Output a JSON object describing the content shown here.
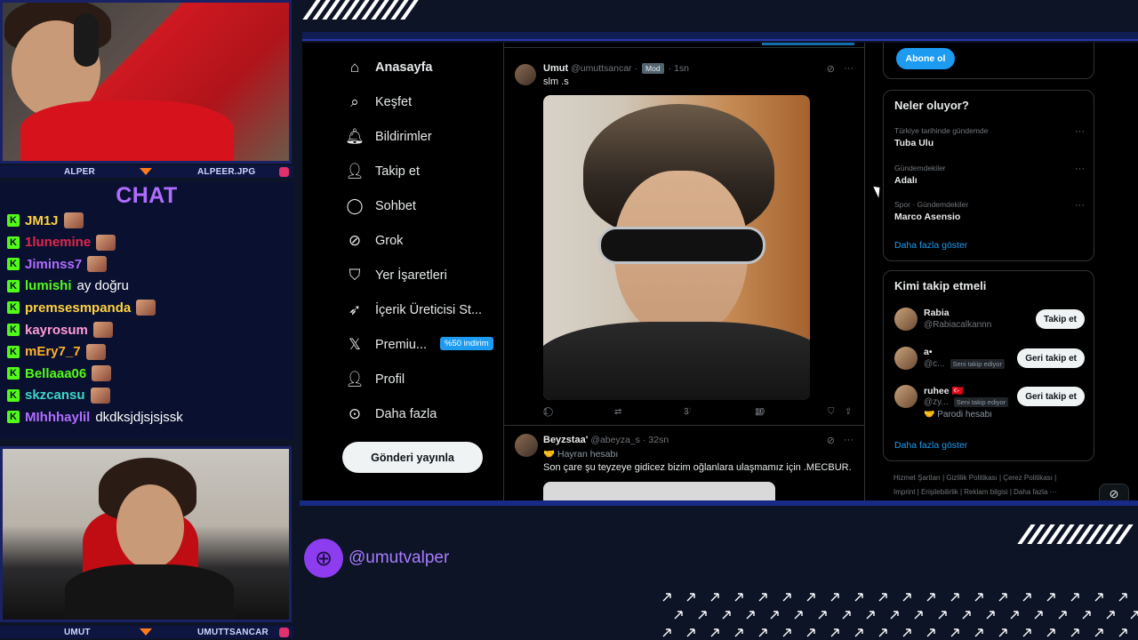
{
  "overlay": {
    "cam_top": {
      "left_name": "ALPER",
      "right_name": "ALPEER.JPG"
    },
    "cam_bottom": {
      "left_name": "UMUT",
      "right_name": "UMUTTSANCAR"
    },
    "chat_title": "CHAT",
    "chat": [
      {
        "user": "JM1J",
        "color": "#ffd23f",
        "msg": "",
        "emote": true
      },
      {
        "user": "1lunemine",
        "color": "#e0264c",
        "msg": "",
        "emote": true
      },
      {
        "user": "Jiminss7",
        "color": "#b06cff",
        "msg": "",
        "emote": true
      },
      {
        "user": "lumishi",
        "color": "#53fc18",
        "msg": "ay doğru",
        "emote": false
      },
      {
        "user": "premsesmpanda",
        "color": "#ffd23f",
        "msg": "",
        "emote": true
      },
      {
        "user": "kayrosum",
        "color": "#ff9ad5",
        "msg": "",
        "emote": true
      },
      {
        "user": "mEry7_7",
        "color": "#ffb02e",
        "msg": "",
        "emote": true
      },
      {
        "user": "Bellaaa06",
        "color": "#53fc18",
        "msg": "",
        "emote": true
      },
      {
        "user": "skzcansu",
        "color": "#3fd6c8",
        "msg": "",
        "emote": true
      },
      {
        "user": "MIhhhaylil",
        "color": "#b06cff",
        "msg": "dkdksjdjsjsjssk",
        "emote": false
      }
    ],
    "handle": "@umutvalper",
    "accent": "#8d3cf0"
  },
  "nav": {
    "items": [
      {
        "label": "Anasayfa",
        "icon": "home-icon",
        "glyph": "⌂",
        "active": true
      },
      {
        "label": "Keşfet",
        "icon": "search-icon",
        "glyph": "⌕"
      },
      {
        "label": "Bildirimler",
        "icon": "bell-icon",
        "glyph": "🔔︎"
      },
      {
        "label": "Takip et",
        "icon": "person-add-icon",
        "glyph": "👤︎"
      },
      {
        "label": "Sohbet",
        "icon": "chat-bubble-icon",
        "glyph": "◯"
      },
      {
        "label": "Grok",
        "icon": "grok-icon",
        "glyph": "⊘"
      },
      {
        "label": "Yer İşaretleri",
        "icon": "bookmark-icon",
        "glyph": "⛉"
      },
      {
        "label": "İçerik Üreticisi St...",
        "icon": "rocket-icon",
        "glyph": "➶"
      },
      {
        "label": "Premiu...",
        "icon": "x-logo-icon",
        "glyph": "𝕏",
        "badge": "%50 indirim"
      },
      {
        "label": "Profil",
        "icon": "profile-icon",
        "glyph": "👤︎"
      },
      {
        "label": "Daha fazla",
        "icon": "more-circle-icon",
        "glyph": "⊙"
      }
    ],
    "post_button": "Gönderi yayınla"
  },
  "feed": {
    "tweet1": {
      "name": "Umut",
      "handle": "@umuttsancar",
      "badge": "Mod",
      "time": "1sn",
      "text": "slm .s",
      "replies": "1",
      "likes": "3",
      "views": "10"
    },
    "tweet2": {
      "name": "Beyzstaa'",
      "handle": "@abeyza_s",
      "time": "32sn",
      "role": "🤝 Hayran hesabı",
      "text": "Son çare şu teyzeye gidicez bizim oğlanlara ulaşmamız için .MECBUR."
    }
  },
  "sidebar": {
    "subscribe": "Abone ol",
    "trends_title": "Neler oluyor?",
    "trends": [
      {
        "category": "Türkiye tarihinde gündemde",
        "name": "Tuba Ulu"
      },
      {
        "category": "Gündemdekiler",
        "name": "Adalı"
      },
      {
        "category": "Spor · Gündemdekiler",
        "name": "Marco Asensio"
      }
    ],
    "show_more": "Daha fazla göster",
    "who_title": "Kimi takip etmeli",
    "who": [
      {
        "name": "Rabia",
        "handle": "@Rabiacalkannn",
        "button": "Takip et",
        "tag": "",
        "bio": ""
      },
      {
        "name": "a•",
        "handle": "@c...",
        "button": "Geri takip et",
        "tag": "Seni takip ediyor",
        "bio": ""
      },
      {
        "name": "ruhee 🇹🇷",
        "handle": "@zy...",
        "button": "Geri takip et",
        "tag": "Seni takip ediyor",
        "bio": "🤝 Parodi hesabı"
      }
    ],
    "show_more2": "Daha fazla göster",
    "footer1": "Hizmet Şartları   |   Gizlilik Politikası   |   Çerez Politikası   |",
    "footer2": "Imprint   |   Erişilebilirlik   |   Reklam bilgisi   |   Daha fazla ···"
  }
}
